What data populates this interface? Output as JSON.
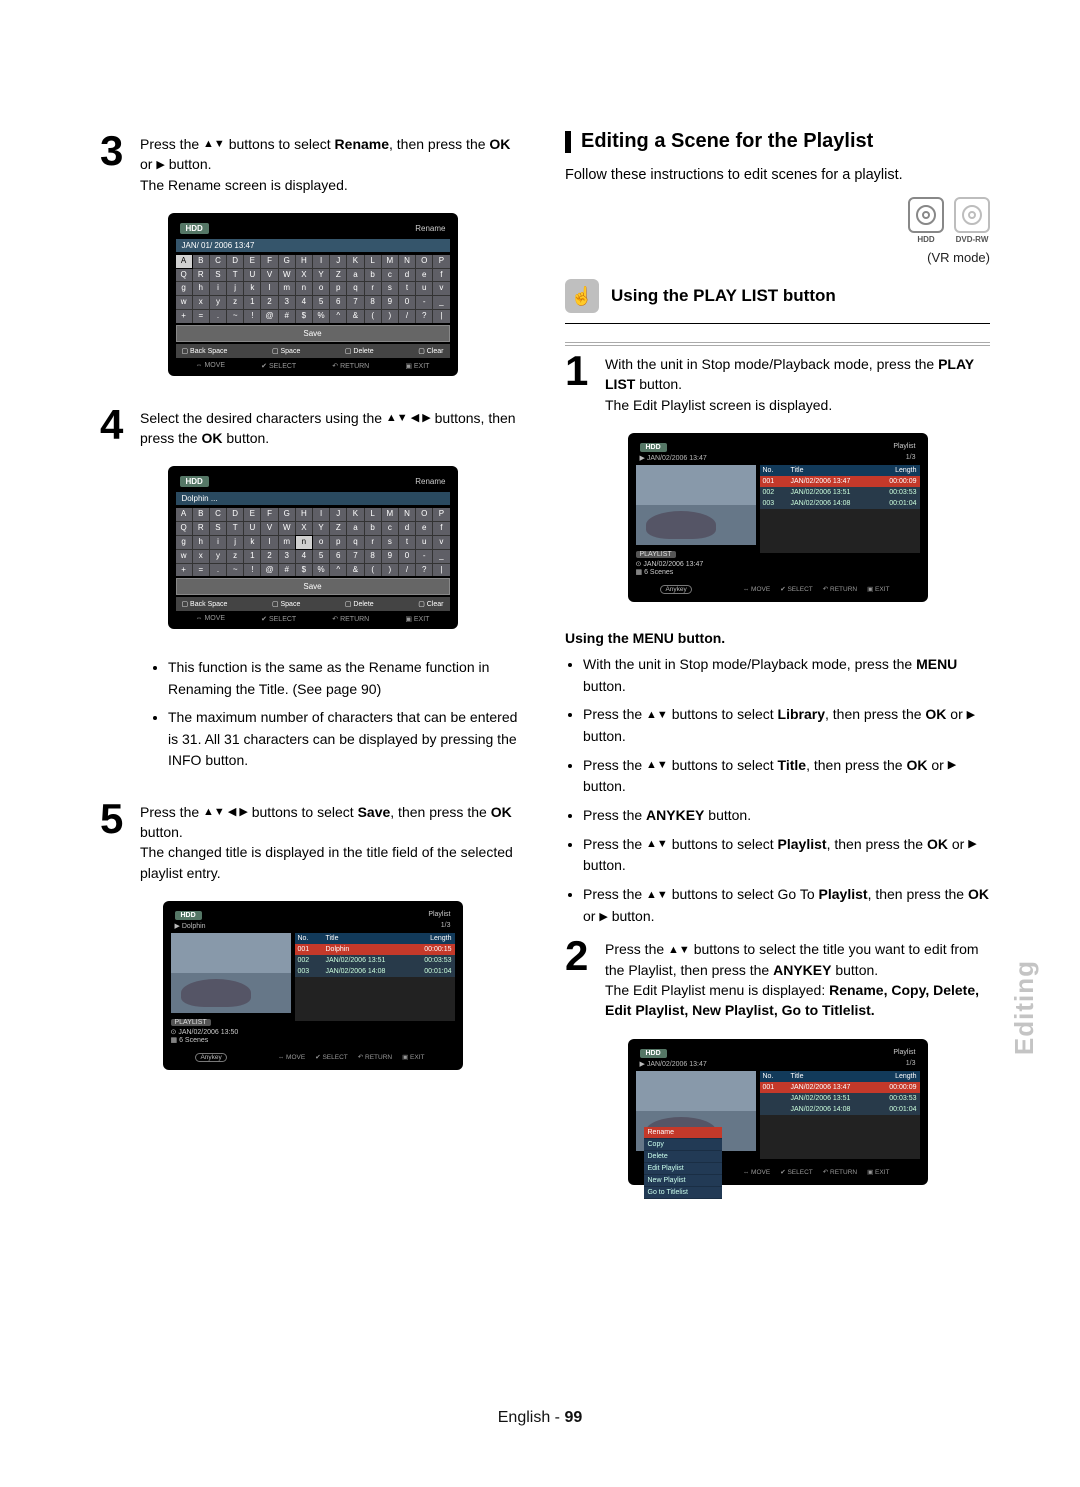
{
  "footer": {
    "lang": "English",
    "page": "99"
  },
  "side_tab": "Editing",
  "left": {
    "step3": {
      "text_a": "Press the ",
      "text_b": " buttons to select ",
      "bold1": "Rename",
      "text_c": ", then press the ",
      "bold2": "OK",
      "text_d": " or ",
      "text_e": " button.",
      "line2": "The Rename screen is displayed."
    },
    "osk1": {
      "hdd": "HDD",
      "label": "Rename",
      "date": "JAN/ 01/ 2006   13:47",
      "rows": [
        [
          "A",
          "B",
          "C",
          "D",
          "E",
          "F",
          "G",
          "H",
          "I",
          "J",
          "K",
          "L",
          "M",
          "N",
          "O",
          "P"
        ],
        [
          "Q",
          "R",
          "S",
          "T",
          "U",
          "V",
          "W",
          "X",
          "Y",
          "Z",
          "a",
          "b",
          "c",
          "d",
          "e",
          "f"
        ],
        [
          "g",
          "h",
          "i",
          "j",
          "k",
          "l",
          "m",
          "n",
          "o",
          "p",
          "q",
          "r",
          "s",
          "t",
          "u",
          "v"
        ],
        [
          "w",
          "x",
          "y",
          "z",
          "1",
          "2",
          "3",
          "4",
          "5",
          "6",
          "7",
          "8",
          "9",
          "0",
          "-",
          "_"
        ],
        [
          "+",
          "=",
          ".",
          "~",
          "!",
          "@",
          "#",
          "$",
          "%",
          "^",
          "&",
          "(",
          ")",
          "/",
          "?",
          "|"
        ]
      ],
      "highlight": [
        0,
        0
      ],
      "save": "Save",
      "fn": [
        "Back Space",
        "Space",
        "Delete",
        "Clear"
      ],
      "nav": [
        "MOVE",
        "SELECT",
        "RETURN",
        "EXIT"
      ]
    },
    "step4": {
      "text_a": "Select the desired characters using the ",
      "text_b": " buttons, then press the ",
      "bold1": "OK",
      "text_c": " button."
    },
    "osk2": {
      "hdd": "HDD",
      "label": "Rename",
      "typed": "Dolphin ...",
      "rows": "same",
      "highlight": [
        2,
        7
      ],
      "save": "Save",
      "fn": [
        "Back Space",
        "Space",
        "Delete",
        "Clear"
      ],
      "nav": [
        "MOVE",
        "SELECT",
        "RETURN",
        "EXIT"
      ]
    },
    "notes": [
      "This function is the same as the Rename function in Renaming the Title. (See page 90)",
      "The maximum number of characters that can be entered is 31. All 31 characters can be displayed by pressing the INFO button."
    ],
    "step5": {
      "text_a": "Press the ",
      "text_b": " buttons to select ",
      "bold1": "Save",
      "text_c": ", then press the ",
      "bold2": "OK",
      "text_d": " button.",
      "line2": "The changed title is displayed in the title field of the selected playlist entry."
    },
    "playlist1": {
      "hdd": "HDD",
      "label": "Playlist",
      "crumb": "Dolphin",
      "page": "1/3",
      "headers": [
        "No.",
        "Title",
        "Length"
      ],
      "rows": [
        {
          "no": "001",
          "title": "Dolphin",
          "len": "00:00:15",
          "sel": true
        },
        {
          "no": "002",
          "title": "JAN/02/2006 13:51",
          "len": "00:03:53"
        },
        {
          "no": "003",
          "title": "JAN/02/2006 14:08",
          "len": "00:01:04"
        }
      ],
      "meta_tag": "PLAYLIST",
      "meta1": "JAN/02/2006 13:50",
      "meta2": "6 Scenes",
      "anykey": "Anykey",
      "nav": [
        "MOVE",
        "SELECT",
        "RETURN",
        "EXIT"
      ]
    }
  },
  "right": {
    "heading": "Editing a Scene for the Playlist",
    "intro": "Follow these instructions to edit scenes for a playlist.",
    "disc_caps": [
      "HDD",
      "DVD-RW"
    ],
    "mode": "(VR mode)",
    "subhead": "Using the PLAY LIST button",
    "step1": {
      "text_a": "With the unit in Stop mode/Playback mode, press the ",
      "bold1": "PLAY LIST",
      "text_b": " button.",
      "line2": "The Edit Playlist screen is displayed."
    },
    "playlist2": {
      "hdd": "HDD",
      "label": "Playlist",
      "crumb": "JAN/02/2006 13:47",
      "page": "1/3",
      "headers": [
        "No.",
        "Title",
        "Length"
      ],
      "rows": [
        {
          "no": "001",
          "title": "JAN/02/2006 13:47",
          "len": "00:00:09",
          "sel": true
        },
        {
          "no": "002",
          "title": "JAN/02/2006 13:51",
          "len": "00:03:53"
        },
        {
          "no": "003",
          "title": "JAN/02/2006 14:08",
          "len": "00:01:04"
        }
      ],
      "meta_tag": "PLAYLIST",
      "meta1": "JAN/02/2006 13:47",
      "meta2": "6 Scenes",
      "anykey": "Anykey",
      "nav": [
        "MOVE",
        "SELECT",
        "RETURN",
        "EXIT"
      ]
    },
    "using_menu": "Using the MENU button.",
    "bullets": [
      "With the unit in Stop mode/Playback mode, press the MENU button.",
      "Press the ▲▼ buttons to select Library, then press the OK or ▶ button.",
      "Press the ▲▼ buttons to select Title, then press the OK or ▶ button.",
      "Press the ANYKEY button.",
      "Press the ▲▼ buttons to select Playlist, then press the OK or ▶ button.",
      "Press the ▲▼ buttons to select Go To Playlist, then press the OK or ▶ button."
    ],
    "step2": {
      "text_a": "Press the ",
      "text_b": " buttons to select the title you want to edit from the Playlist, then press the ",
      "bold1": "ANYKEY",
      "text_c": " button.",
      "line2a": "The Edit Playlist menu is displayed: ",
      "menu_items": "Rename, Copy, Delete, Edit Playlist, New Playlist, Go to Titlelist."
    },
    "playlist3": {
      "hdd": "HDD",
      "label": "Playlist",
      "crumb": "JAN/02/2006 13:47",
      "page": "1/3",
      "headers": [
        "No.",
        "Title",
        "Length"
      ],
      "rows": [
        {
          "no": "001",
          "title": "JAN/02/2006 13:47",
          "len": "00:00:09",
          "sel": true
        },
        {
          "no": "",
          "title": "JAN/02/2006 13:51",
          "len": "00:03:53"
        },
        {
          "no": "",
          "title": "JAN/02/2006 14:08",
          "len": "00:01:04"
        }
      ],
      "menu": [
        "Rename",
        "Copy",
        "Delete",
        "Edit Playlist",
        "New Playlist",
        "Go to Titlelist"
      ],
      "menu_sel": 0,
      "anykey": "Anykey",
      "nav": [
        "MOVE",
        "SELECT",
        "RETURN",
        "EXIT"
      ]
    }
  }
}
